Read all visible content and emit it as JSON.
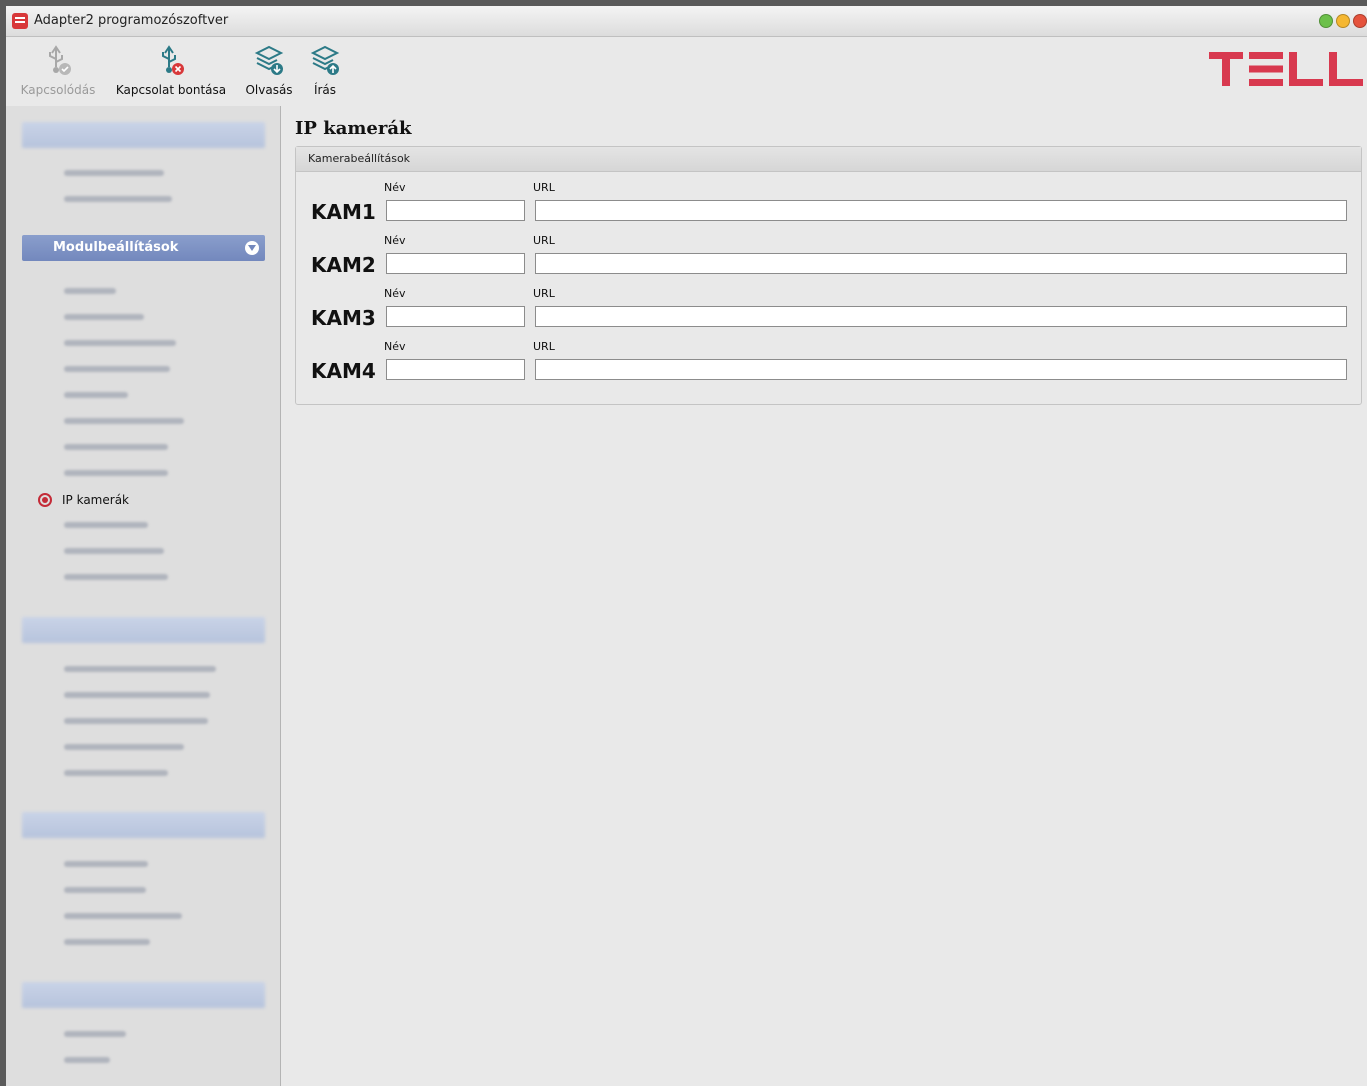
{
  "window": {
    "title": "Adapter2 programozószoftver"
  },
  "toolbar": {
    "connect_label": "Kapcsolódás",
    "disconnect_label": "Kapcsolat bontása",
    "read_label": "Olvasás",
    "write_label": "Írás"
  },
  "brand": {
    "logo_text": "TELL",
    "color": "#d8394f"
  },
  "sidebar": {
    "active_section": "Modulbeállítások",
    "active_item": "IP kamerák"
  },
  "main": {
    "title": "IP kamerák",
    "panel_title": "Kamerabeállítások",
    "name_label": "Név",
    "url_label": "URL",
    "cameras": [
      {
        "label": "KAM1",
        "name": "",
        "url": ""
      },
      {
        "label": "KAM2",
        "name": "",
        "url": ""
      },
      {
        "label": "KAM3",
        "name": "",
        "url": ""
      },
      {
        "label": "KAM4",
        "name": "",
        "url": ""
      }
    ]
  },
  "icons": {
    "app": "app-icon",
    "connect": "usb-check-icon",
    "disconnect": "usb-x-icon",
    "read": "layers-download-icon",
    "write": "layers-upload-icon",
    "section_toggle": "chevron-down-icon",
    "active_item": "radio-selected-icon"
  }
}
